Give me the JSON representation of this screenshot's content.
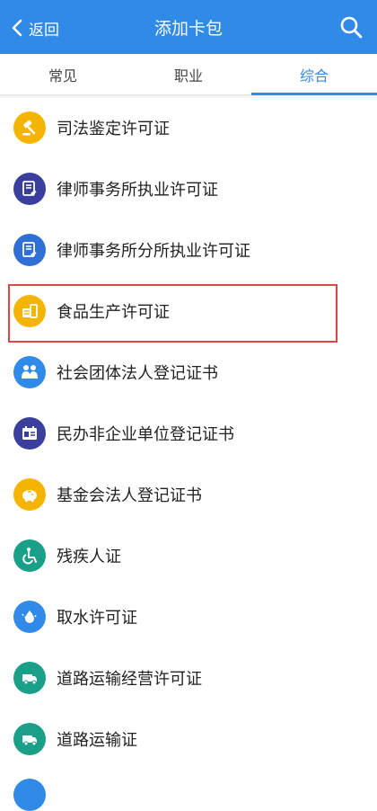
{
  "header": {
    "back_label": "返回",
    "title": "添加卡包"
  },
  "tabs": [
    {
      "label": "常见",
      "active": false
    },
    {
      "label": "职业",
      "active": false
    },
    {
      "label": "综合",
      "active": true
    }
  ],
  "items": [
    {
      "label": "司法鉴定许可证",
      "icon": "gavel-icon",
      "color": "#f5b400"
    },
    {
      "label": "律师事务所执业许可证",
      "icon": "document-gavel-icon",
      "color": "#3a3f9e"
    },
    {
      "label": "律师事务所分所执业许可证",
      "icon": "document-gavel-icon",
      "color": "#2f6fd6"
    },
    {
      "label": "食品生产许可证",
      "icon": "food-license-icon",
      "color": "#f5b400"
    },
    {
      "label": "社会团体法人登记证书",
      "icon": "people-icon",
      "color": "#2f8ae8"
    },
    {
      "label": "民办非企业单位登记证书",
      "icon": "calendar-id-icon",
      "color": "#3a3f9e"
    },
    {
      "label": "基金会法人登记证书",
      "icon": "piggy-bank-icon",
      "color": "#f5b400"
    },
    {
      "label": "残疾人证",
      "icon": "wheelchair-icon",
      "color": "#1aa089"
    },
    {
      "label": "取水许可证",
      "icon": "water-drop-icon",
      "color": "#2f8ae8"
    },
    {
      "label": "道路运输经营许可证",
      "icon": "truck-icon",
      "color": "#1aa089"
    },
    {
      "label": "道路运输证",
      "icon": "truck-icon",
      "color": "#1aa089"
    }
  ],
  "colors": {
    "accent": "#2f8ae8",
    "highlight_border": "#e0454a"
  }
}
